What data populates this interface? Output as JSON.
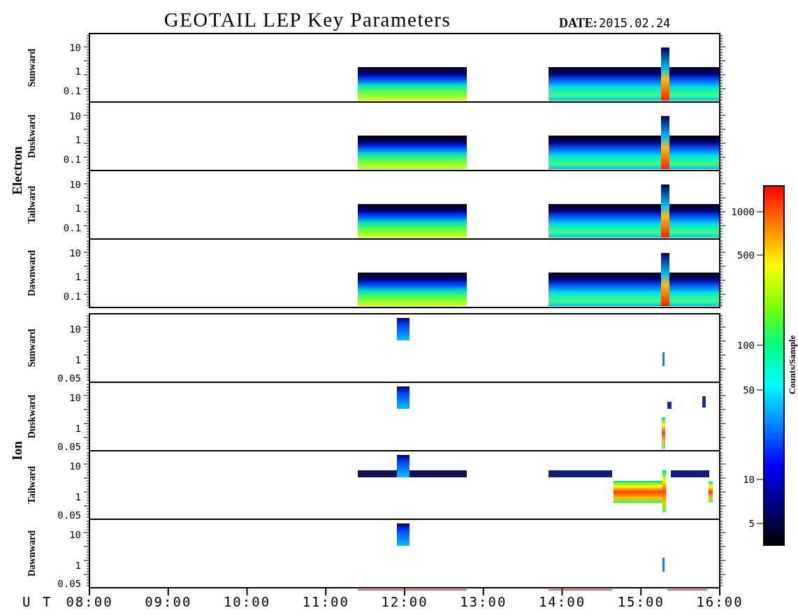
{
  "title": "GEOTAIL LEP Key Parameters",
  "date_label": "DATE:",
  "date": "2015.02.24",
  "groups": [
    {
      "label": "Electron",
      "kind": "electron",
      "panels": [
        {
          "label": "Sunward",
          "yticks": [
            "10",
            "1",
            "0.1"
          ]
        },
        {
          "label": "Duskward",
          "yticks": [
            "10",
            "1",
            "0.1"
          ]
        },
        {
          "label": "Tailward",
          "yticks": [
            "10",
            "1",
            "0.1"
          ]
        },
        {
          "label": "Dawnward",
          "yticks": [
            "10",
            "1",
            "0.1"
          ]
        }
      ]
    },
    {
      "label": "Ion",
      "kind": "ion",
      "panels": [
        {
          "label": "Sunward",
          "yticks": [
            "10",
            "1",
            "0.05"
          ]
        },
        {
          "label": "Duskward",
          "yticks": [
            "10",
            "1",
            "0.05"
          ]
        },
        {
          "label": "Tailward",
          "yticks": [
            "10",
            "1",
            "0.05"
          ]
        },
        {
          "label": "Dawnward",
          "yticks": [
            "10",
            "1",
            "0.05"
          ]
        }
      ]
    }
  ],
  "time_axis": {
    "label": "U T",
    "ticks": [
      "08:00",
      "09:00",
      "10:00",
      "11:00",
      "12:00",
      "13:00",
      "14:00",
      "15:00",
      "16:00"
    ]
  },
  "colorbar": {
    "label": "Counts/Sample",
    "ticks": [
      "1000",
      "500",
      "100",
      "50",
      "10",
      "5"
    ]
  }
}
